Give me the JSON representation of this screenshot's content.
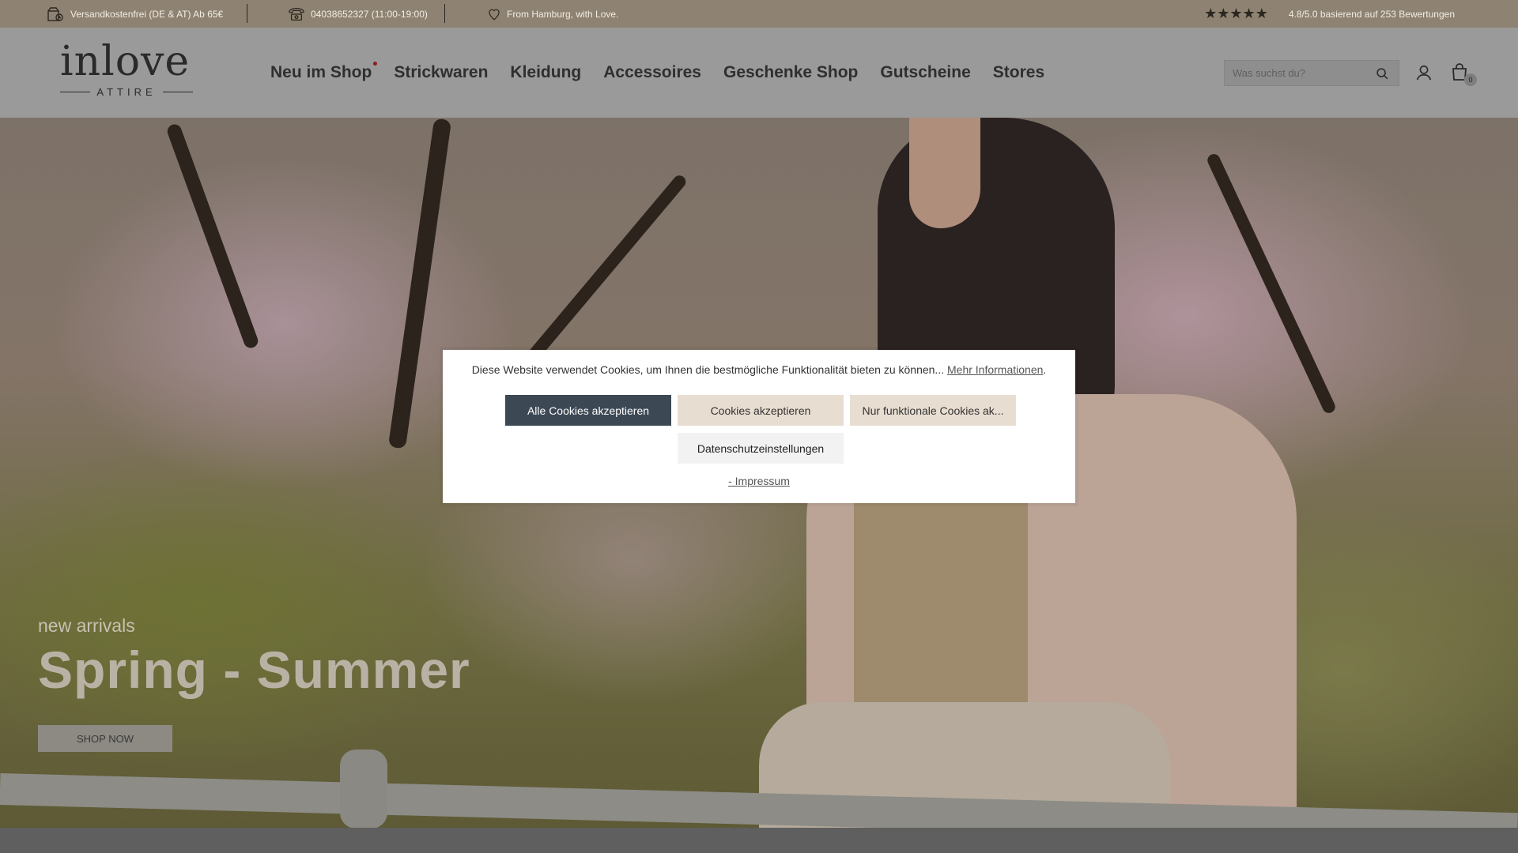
{
  "topbar": {
    "shipping": "Versandkostenfrei (DE & AT) Ab 65€",
    "phone": "04038652327 (11:00-19:00)",
    "tagline": "From Hamburg, with Love.",
    "rating_text": "4.8/5.0 basierend auf 253 Bewertungen",
    "stars": "★★★★★"
  },
  "header": {
    "logo_word": "inlove",
    "logo_sub": "ATTIRE",
    "nav": [
      "Neu im Shop",
      "Strickwaren",
      "Kleidung",
      "Accessoires",
      "Geschenke Shop",
      "Gutscheine",
      "Stores"
    ],
    "search_placeholder": "Was suchst du?",
    "cart_count": "0"
  },
  "hero": {
    "kicker": "new arrivals",
    "title": "Spring - Summer",
    "cta": "SHOP NOW"
  },
  "cookie": {
    "message": "Diese Website verwendet Cookies, um Ihnen die bestmögliche Funktionalität bieten zu können...",
    "more_info": "Mehr Informationen",
    "accept_all": "Alle Cookies akzeptieren",
    "accept": "Cookies akzeptieren",
    "functional_only": "Nur funktionale Cookies ak...",
    "privacy_settings": "Datenschutzeinstellungen",
    "imprint": "- Impressum"
  },
  "colors": {
    "topbar": "#8e8372",
    "header": "#9a9a9a",
    "accept_all_bg": "#3d4855",
    "accept_bg": "#e8ddd1",
    "logo_heart": "#8b1d1d"
  }
}
